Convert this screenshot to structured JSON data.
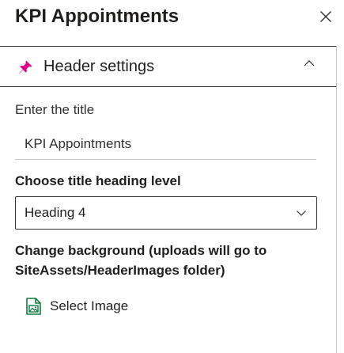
{
  "panel": {
    "title": "KPI Appointments",
    "close_icon": "close-icon"
  },
  "section": {
    "title": "Header settings",
    "icon": "pin-icon",
    "toggle_icon": "chevron-up-icon",
    "accent_color": "#e3008c"
  },
  "title_field": {
    "label": "Enter the title",
    "value": "KPI Appointments"
  },
  "heading_level": {
    "label": "Choose title heading level",
    "selected": "Heading 4",
    "toggle_icon": "chevron-down-icon"
  },
  "background": {
    "label": "Change background (uploads will go to SiteAssets/HeaderImages folder)",
    "button_label": "Select Image",
    "button_icon": "image-file-icon",
    "icon_color": "#107c41"
  }
}
